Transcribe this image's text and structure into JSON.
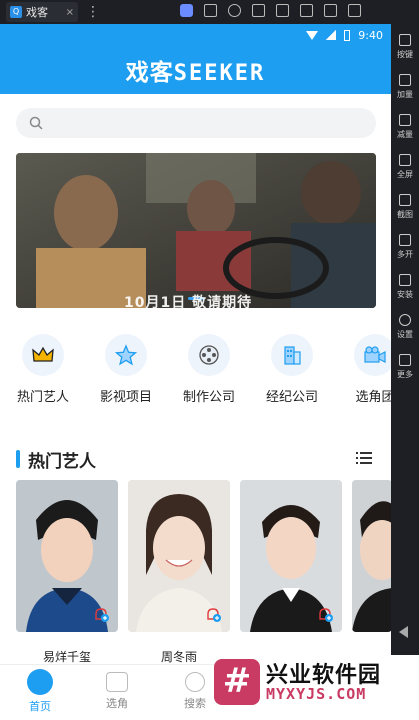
{
  "window": {
    "tab_title": "戏客",
    "close": "×",
    "menu": "⋮"
  },
  "status": {
    "time": "9:40"
  },
  "header": {
    "brand_cn": "戏客",
    "brand_en": "SEEKER"
  },
  "banner": {
    "caption": "10月1日 敬请期待"
  },
  "categories": [
    {
      "label": "热门艺人",
      "icon": "crown-icon"
    },
    {
      "label": "影视项目",
      "icon": "star-icon"
    },
    {
      "label": "制作公司",
      "icon": "film-reel-icon"
    },
    {
      "label": "经纪公司",
      "icon": "building-icon"
    },
    {
      "label": "选角团",
      "icon": "camera-icon"
    }
  ],
  "section": {
    "title": "热门艺人"
  },
  "artists": [
    {
      "name": "易烊千玺"
    },
    {
      "name": "周冬雨"
    },
    {
      "name": ""
    }
  ],
  "bottom_nav": [
    {
      "label": "首页",
      "active": true
    },
    {
      "label": "选角",
      "active": false
    },
    {
      "label": "搜索",
      "active": false
    }
  ],
  "sidebar": [
    {
      "label": "按键"
    },
    {
      "label": "加量"
    },
    {
      "label": "减量"
    },
    {
      "label": "全屏"
    },
    {
      "label": "截图"
    },
    {
      "label": "多开"
    },
    {
      "label": "安装"
    },
    {
      "label": "设置"
    },
    {
      "label": "更多"
    }
  ],
  "watermark": {
    "cn": "兴业软件园",
    "en": "MYXYJS.COM",
    "logo": "#"
  },
  "colors": {
    "primary": "#1e9ef0",
    "watermark": "#c93b62"
  }
}
